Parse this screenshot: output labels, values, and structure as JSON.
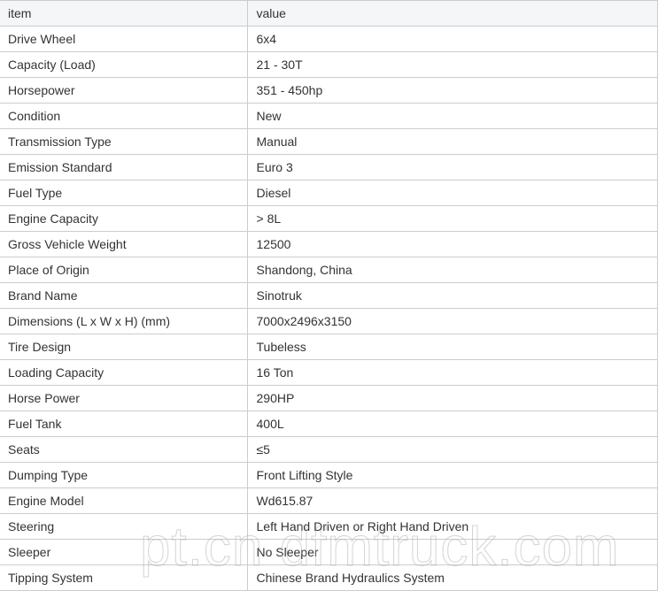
{
  "table": {
    "headers": {
      "item": "item",
      "value": "value"
    },
    "rows": [
      {
        "item": "Drive Wheel",
        "value": "6x4"
      },
      {
        "item": "Capacity (Load)",
        "value": "21 - 30T"
      },
      {
        "item": "Horsepower",
        "value": "351 - 450hp"
      },
      {
        "item": "Condition",
        "value": "New"
      },
      {
        "item": "Transmission Type",
        "value": "Manual"
      },
      {
        "item": "Emission Standard",
        "value": "Euro 3"
      },
      {
        "item": "Fuel Type",
        "value": "Diesel"
      },
      {
        "item": "Engine Capacity",
        "value": "> 8L"
      },
      {
        "item": "Gross Vehicle Weight",
        "value": "12500"
      },
      {
        "item": "Place of Origin",
        "value": "Shandong, China"
      },
      {
        "item": "Brand Name",
        "value": "Sinotruk"
      },
      {
        "item": "Dimensions (L x W x H) (mm)",
        "value": "7000x2496x3150"
      },
      {
        "item": "Tire Design",
        "value": "Tubeless"
      },
      {
        "item": "Loading Capacity",
        "value": "16 Ton"
      },
      {
        "item": "Horse Power",
        "value": "290HP"
      },
      {
        "item": "Fuel Tank",
        "value": "400L"
      },
      {
        "item": "Seats",
        "value": "≤5"
      },
      {
        "item": "Dumping Type",
        "value": "Front Lifting Style"
      },
      {
        "item": "Engine Model",
        "value": "Wd615.87"
      },
      {
        "item": "Steering",
        "value": "Left Hand Driven or Right Hand Driven"
      },
      {
        "item": "Sleeper",
        "value": "No Sleeper"
      },
      {
        "item": "Tipping System",
        "value": "Chinese Brand Hydraulics System"
      }
    ]
  },
  "watermark": "pt.cn dfmtruck.com",
  "colors": {
    "header_bg": "#f5f6f8",
    "border": "#cccccc",
    "text": "#333333"
  }
}
